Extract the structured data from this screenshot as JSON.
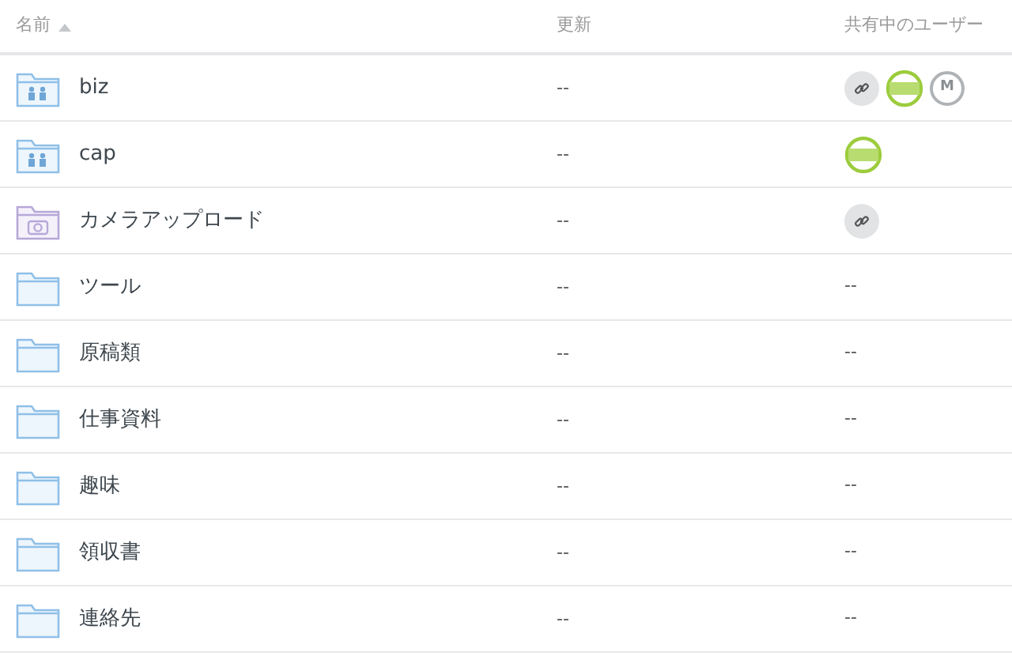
{
  "columns": [
    {
      "label": "名前",
      "sort_ascending": true
    },
    {
      "label": "更新"
    },
    {
      "label": "共有中のユーザー"
    }
  ],
  "rows": [
    {
      "kind": "shared",
      "name": "biz",
      "updated": "--",
      "users": [
        {
          "kind": "link"
        },
        {
          "kind": "avatar"
        },
        {
          "kind": "initial",
          "text": "M"
        }
      ]
    },
    {
      "kind": "shared",
      "name": "cap",
      "updated": "--",
      "users": [
        {
          "kind": "avatar"
        }
      ]
    },
    {
      "kind": "camera",
      "name": "カメラアップロード",
      "updated": "--",
      "users": [
        {
          "kind": "link"
        }
      ]
    },
    {
      "kind": "plain",
      "name": "ツール",
      "updated": "--",
      "shared": "--"
    },
    {
      "kind": "plain",
      "name": "原稿類",
      "updated": "--",
      "shared": "--"
    },
    {
      "kind": "plain",
      "name": "仕事資料",
      "updated": "--",
      "shared": "--"
    },
    {
      "kind": "plain",
      "name": "趣味",
      "updated": "--",
      "shared": "--"
    },
    {
      "kind": "plain",
      "name": "領収書",
      "updated": "--",
      "shared": "--"
    },
    {
      "kind": "plain",
      "name": "連絡先",
      "updated": "--",
      "shared": "--"
    }
  ]
}
